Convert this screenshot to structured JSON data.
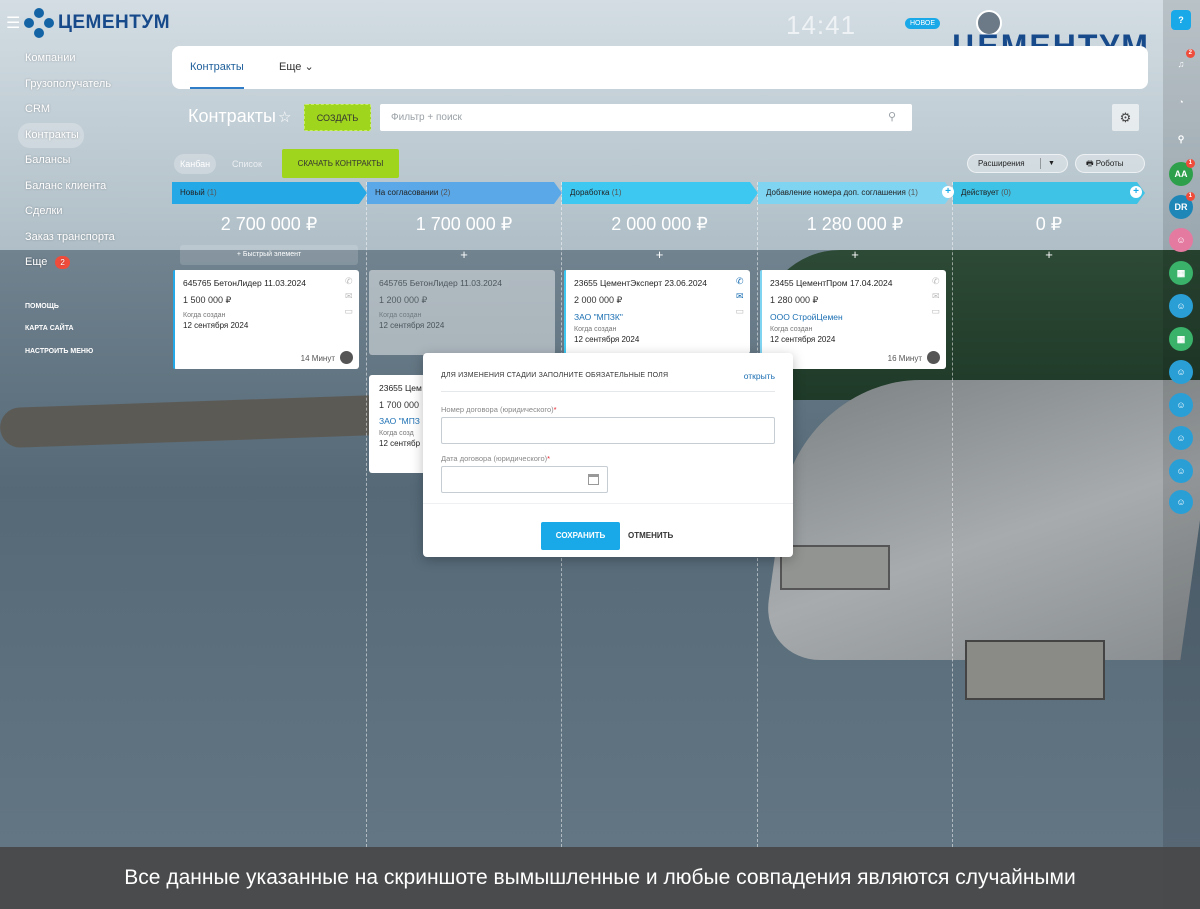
{
  "header": {
    "brand": "ЦЕМЕНТУМ",
    "brand_large": "ЦЕМЕНТУМ",
    "clock": "14:41",
    "new_badge": "НОВОЕ"
  },
  "left_menu": {
    "items": [
      {
        "label": "Компании"
      },
      {
        "label": "Грузополучатель"
      },
      {
        "label": "CRM"
      },
      {
        "label": "Контракты",
        "active": true
      },
      {
        "label": "Балансы"
      },
      {
        "label": "Баланс клиента"
      },
      {
        "label": "Сделки"
      },
      {
        "label": "Заказ транспорта"
      },
      {
        "label": "Еще",
        "badge": "2"
      }
    ],
    "bottom": [
      "ПОМОЩЬ",
      "КАРТА САЙТА",
      "НАСТРОИТЬ МЕНЮ"
    ]
  },
  "tabs": [
    {
      "label": "Контракты",
      "active": true
    },
    {
      "label": "Еще"
    }
  ],
  "toolbar": {
    "page_title": "Контракты",
    "create_label": "СОЗДАТЬ",
    "search_placeholder": "Фильтр + поиск",
    "view_kanban": "Канбан",
    "view_list": "Список",
    "download_label": "СКАЧАТЬ КОНТРАКТЫ",
    "extensions_label": "Расширения",
    "robots_label": "Роботы"
  },
  "colors": {
    "accent_green": "#9fd51c",
    "accent_blue": "#1aa9e8",
    "link": "#1b6fb3"
  },
  "columns": [
    {
      "name": "Новый",
      "count": "(1)",
      "sum": "2 700 000 ₽",
      "color": "#25a8e6",
      "quick_add": "Быстрый элемент"
    },
    {
      "name": "На согласовании",
      "count": "(2)",
      "sum": "1 700 000 ₽",
      "color": "#5aa8e8"
    },
    {
      "name": "Доработка",
      "count": "(1)",
      "sum": "2 000 000 ₽",
      "color": "#3dc8f2"
    },
    {
      "name": "Добавление номера доп. соглашения",
      "count": "(1)",
      "sum": "1 280 000 ₽",
      "color": "#7fd4f2"
    },
    {
      "name": "Действует",
      "count": "(0)",
      "sum": "0 ₽",
      "color": "#3ec2e5"
    }
  ],
  "cards": [
    {
      "title": "645765 БетонЛидер 11.03.2024",
      "amount": "1 500 000 ₽",
      "created_label": "Когда создан",
      "created": "12 сентября 2024",
      "time": "14 Минут"
    },
    {
      "title": "645765 БетонЛидер 11.03.2024",
      "amount": "1 200 000 ₽",
      "created_label": "Когда создан",
      "created": "12 сентября 2024"
    },
    {
      "title": "23655 Цем",
      "amount": "1 700 000",
      "org": "ЗАО \"МПЗ",
      "created_label": "Когда созд",
      "created": "12 сентябр"
    },
    {
      "title": "23655 ЦементЭксперт 23.06.2024",
      "amount": "2 000 000 ₽",
      "org": "ЗАО \"МПЗК\"",
      "created_label": "Когда создан",
      "created": "12 сентября 2024"
    },
    {
      "title": "23455 ЦементПром 17.04.2024",
      "amount": "1 280 000 ₽",
      "org": "ООО СтройЦемен",
      "created_label": "Когда создан",
      "created": "12 сентября 2024",
      "time": "16 Минут"
    }
  ],
  "modal": {
    "title": "ДЛЯ ИЗМЕНЕНИЯ СТАДИИ ЗАПОЛНИТЕ ОБЯЗАТЕЛЬНЫЕ ПОЛЯ",
    "open_link": "открыть",
    "field1_label": "Номер договора (юридического)",
    "field2_label": "Дата договора (юридического)",
    "required_mark": "*",
    "save_label": "СОХРАНИТЬ",
    "cancel_label": "ОТМЕНИТЬ"
  },
  "right_bar": {
    "help": "?",
    "notifications_badge": "2",
    "avatars": [
      {
        "initials": "AA",
        "badge": "1"
      },
      {
        "initials": "DR",
        "badge": "1"
      }
    ]
  },
  "disclaimer": "Все данные указанные на скриншоте вымышленные и любые совпадения являются случайными"
}
